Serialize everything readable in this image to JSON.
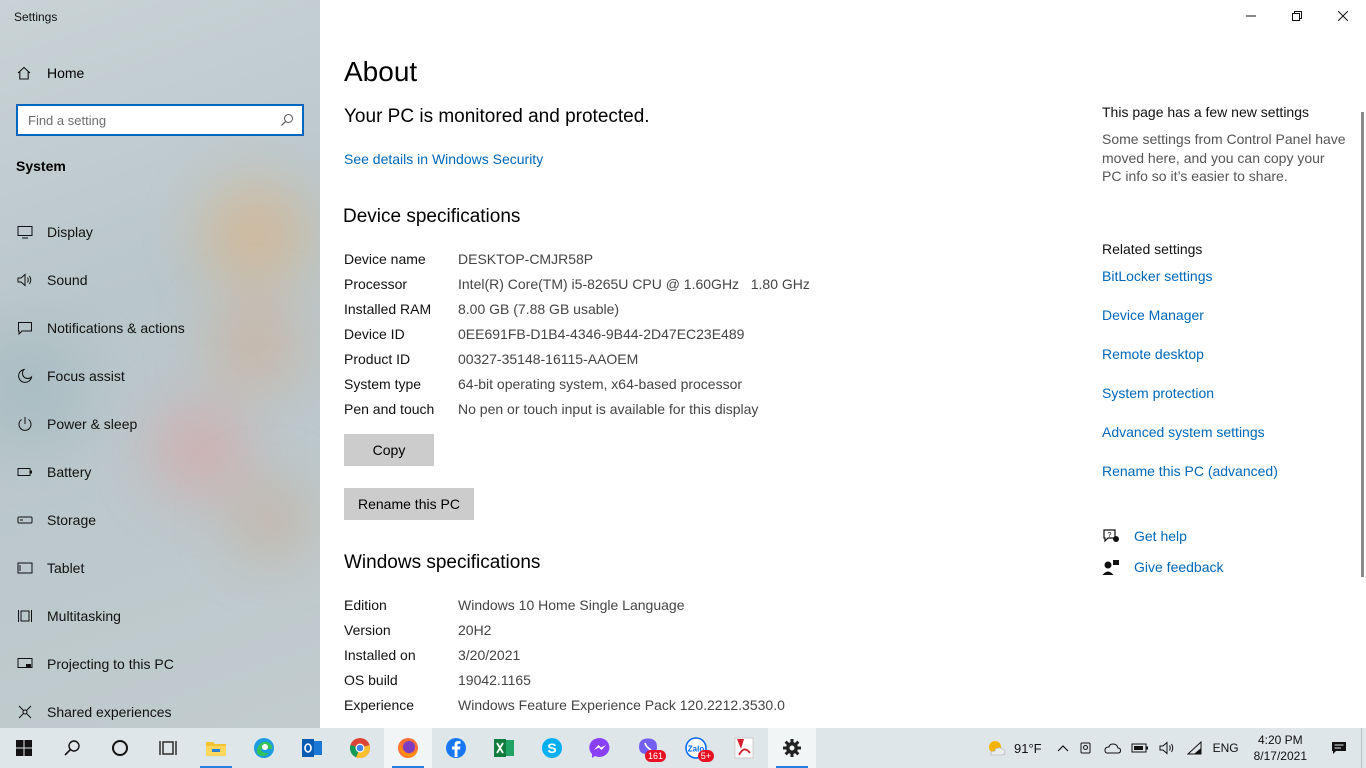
{
  "window": {
    "title": "Settings"
  },
  "sidebar": {
    "home_label": "Home",
    "search_placeholder": "Find a setting",
    "section_title": "System",
    "items": [
      {
        "label": "Display",
        "icon": "monitor-icon"
      },
      {
        "label": "Sound",
        "icon": "speaker-icon"
      },
      {
        "label": "Notifications & actions",
        "icon": "notification-icon"
      },
      {
        "label": "Focus assist",
        "icon": "moon-icon"
      },
      {
        "label": "Power & sleep",
        "icon": "power-icon"
      },
      {
        "label": "Battery",
        "icon": "battery-icon"
      },
      {
        "label": "Storage",
        "icon": "storage-icon"
      },
      {
        "label": "Tablet",
        "icon": "tablet-icon"
      },
      {
        "label": "Multitasking",
        "icon": "multitasking-icon"
      },
      {
        "label": "Projecting to this PC",
        "icon": "projecting-icon"
      },
      {
        "label": "Shared experiences",
        "icon": "shared-icon"
      }
    ]
  },
  "main": {
    "title": "About",
    "protection_status": "Your PC is monitored and protected.",
    "security_link": "See details in Windows Security",
    "device_specs": {
      "header": "Device specifications",
      "rows": [
        {
          "key": "Device name",
          "value": "DESKTOP-CMJR58P"
        },
        {
          "key": "Processor",
          "value": "Intel(R) Core(TM) i5-8265U CPU @ 1.60GHz   1.80 GHz"
        },
        {
          "key": "Installed RAM",
          "value": "8.00 GB (7.88 GB usable)"
        },
        {
          "key": "Device ID",
          "value": "0EE691FB-D1B4-4346-9B44-2D47EC23E489"
        },
        {
          "key": "Product ID",
          "value": "00327-35148-16115-AAOEM"
        },
        {
          "key": "System type",
          "value": "64-bit operating system, x64-based processor"
        },
        {
          "key": "Pen and touch",
          "value": "No pen or touch input is available for this display"
        }
      ],
      "copy_button": "Copy",
      "rename_button": "Rename this PC"
    },
    "windows_specs": {
      "header": "Windows specifications",
      "rows": [
        {
          "key": "Edition",
          "value": "Windows 10 Home Single Language"
        },
        {
          "key": "Version",
          "value": "20H2"
        },
        {
          "key": "Installed on",
          "value": "3/20/2021"
        },
        {
          "key": "OS build",
          "value": "19042.1165"
        },
        {
          "key": "Experience",
          "value": "Windows Feature Experience Pack 120.2212.3530.0"
        }
      ]
    }
  },
  "aside": {
    "new_settings_header": "This page has a few new settings",
    "new_settings_desc": "Some settings from Control Panel have moved here, and you can copy your PC info so it’s easier to share.",
    "related_header": "Related settings",
    "related_links": [
      "BitLocker settings",
      "Device Manager",
      "Remote desktop",
      "System protection",
      "Advanced system settings",
      "Rename this PC (advanced)"
    ],
    "get_help": "Get help",
    "give_feedback": "Give feedback"
  },
  "taskbar": {
    "apps": [
      {
        "name": "start-button",
        "icon": "windows-logo-icon"
      },
      {
        "name": "search-button",
        "icon": "search-icon"
      },
      {
        "name": "cortana-button",
        "icon": "cortana-icon"
      },
      {
        "name": "task-view-button",
        "icon": "task-view-icon"
      },
      {
        "name": "file-explorer",
        "icon": "folder-icon"
      },
      {
        "name": "edge",
        "icon": "edge-icon"
      },
      {
        "name": "outlook",
        "icon": "outlook-icon"
      },
      {
        "name": "chrome",
        "icon": "chrome-icon"
      },
      {
        "name": "firefox",
        "icon": "firefox-icon"
      },
      {
        "name": "facebook",
        "icon": "facebook-icon"
      },
      {
        "name": "excel",
        "icon": "excel-icon"
      },
      {
        "name": "skype",
        "icon": "skype-icon"
      },
      {
        "name": "messenger",
        "icon": "messenger-icon"
      },
      {
        "name": "viber",
        "icon": "viber-icon"
      },
      {
        "name": "zalo",
        "icon": "zalo-icon"
      },
      {
        "name": "acrobat",
        "icon": "acrobat-icon"
      },
      {
        "name": "settings",
        "icon": "gear-icon"
      }
    ],
    "viber_badge": "161",
    "zalo_badge": "5+",
    "weather_temp": "91°F",
    "language": "ENG",
    "time": "4:20 PM",
    "date": "8/17/2021"
  },
  "colors": {
    "accent": "#0067b8",
    "taskbar_bg": "#dfe6ea",
    "button_bg": "#cccccc"
  }
}
